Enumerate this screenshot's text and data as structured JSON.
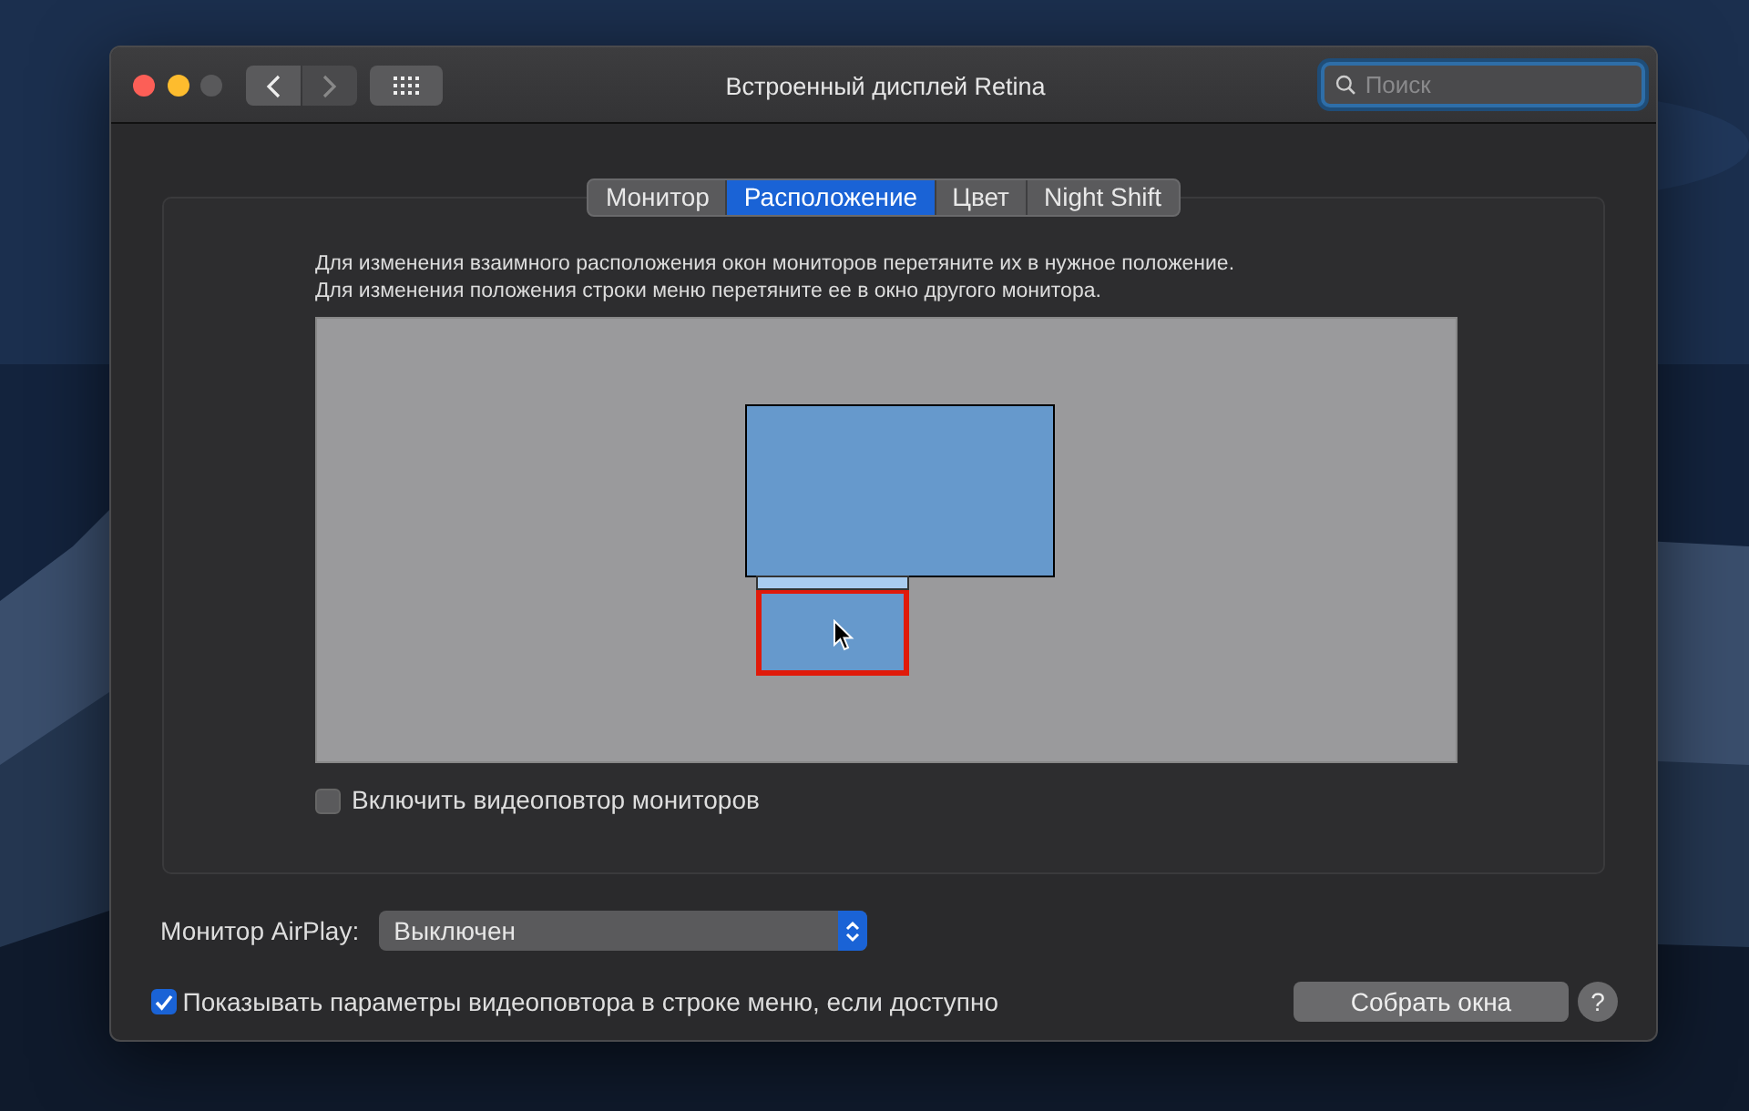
{
  "window": {
    "title": "Встроенный дисплей Retina"
  },
  "search": {
    "placeholder": "Поиск"
  },
  "tabs": [
    {
      "label": "Монитор",
      "selected": false
    },
    {
      "label": "Расположение",
      "selected": true
    },
    {
      "label": "Цвет",
      "selected": false
    },
    {
      "label": "Night Shift",
      "selected": false
    }
  ],
  "arrangement": {
    "instructions": [
      "Для изменения взаимного расположения окон мониторов перетяните их в нужное положение.",
      "Для изменения положения строки меню перетяните ее в окно другого монитора."
    ],
    "displays": [
      {
        "kind": "main",
        "menu_bar": false,
        "selected": false
      },
      {
        "kind": "secondary",
        "menu_bar": true,
        "selected": true
      }
    ]
  },
  "mirroring": {
    "label": "Включить видеоповтор мониторов",
    "checked": false
  },
  "airplay": {
    "label": "Монитор AirPlay:",
    "value": "Выключен"
  },
  "show_in_menu": {
    "label": "Показывать параметры видеоповтора в строке меню, если доступно",
    "checked": true
  },
  "gather_button": "Собрать окна",
  "help_button": "?"
}
